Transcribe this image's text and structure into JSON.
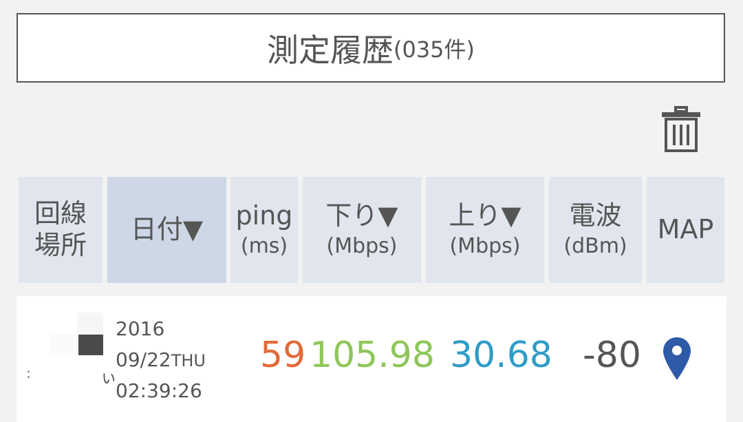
{
  "title": {
    "main": "測定履歴",
    "count": "(035件)"
  },
  "toolbar": {
    "delete_icon": "trash-icon"
  },
  "columns": [
    {
      "id": "line",
      "label": "回線\n場所",
      "sub": ""
    },
    {
      "id": "date",
      "label": "日付▼",
      "sub": ""
    },
    {
      "id": "ping",
      "label": "ping",
      "sub": "(ms)"
    },
    {
      "id": "down",
      "label": "下り▼",
      "sub": "(Mbps)"
    },
    {
      "id": "up",
      "label": "上り▼",
      "sub": "(Mbps)"
    },
    {
      "id": "signal",
      "label": "電波",
      "sub": "(dBm)"
    },
    {
      "id": "map",
      "label": "MAP",
      "sub": ""
    }
  ],
  "rows": [
    {
      "location_mark": ":",
      "location_glyph": "ぃ",
      "year": "2016",
      "date": "09/22",
      "weekday": "THU",
      "time": "02:39:26",
      "ping": "59",
      "down": "105.98",
      "up": "30.68",
      "signal": "-80",
      "map_icon": "map-pin-icon"
    }
  ],
  "colors": {
    "ping": "#e26a3a",
    "down": "#8ec65a",
    "up": "#2f9cc8",
    "pin": "#2f5aa8",
    "header_bg": "#e1e6ee",
    "header_active_bg": "#cdd7e6"
  }
}
